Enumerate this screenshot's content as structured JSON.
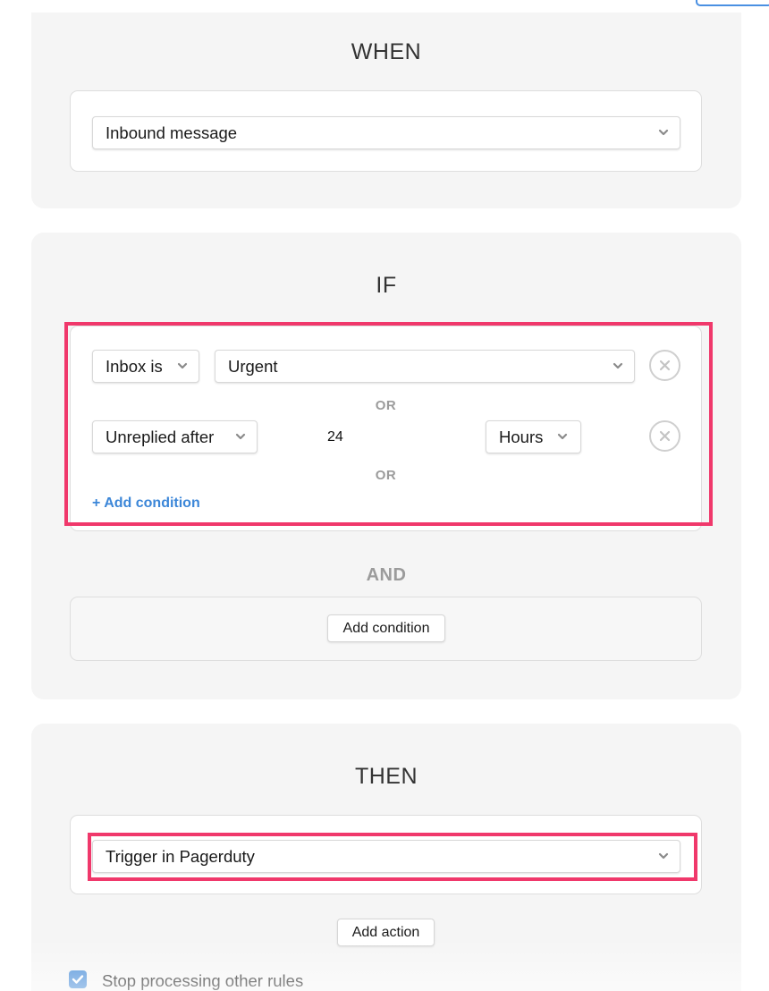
{
  "when": {
    "title": "WHEN",
    "trigger_select": "Inbound message"
  },
  "if": {
    "title": "IF",
    "conditions": [
      {
        "field": "Inbox is",
        "value": "Urgent"
      },
      {
        "field": "Unreplied after",
        "value": "24",
        "unit": "Hours"
      }
    ],
    "or_label": "OR",
    "add_condition_link": "+ Add condition",
    "and_label": "AND",
    "add_condition_button": "Add condition"
  },
  "then": {
    "title": "THEN",
    "action_select": "Trigger in Pagerduty",
    "add_action_button": "Add action",
    "stop_processing_label": "Stop processing other rules",
    "stop_processing_checked": true
  },
  "colors": {
    "highlight": "#f0386b",
    "link": "#3b86d8",
    "checkbox": "#3f87d6"
  },
  "icons": [
    "chevron-down-icon",
    "close-circle-icon",
    "checkmark-icon"
  ]
}
